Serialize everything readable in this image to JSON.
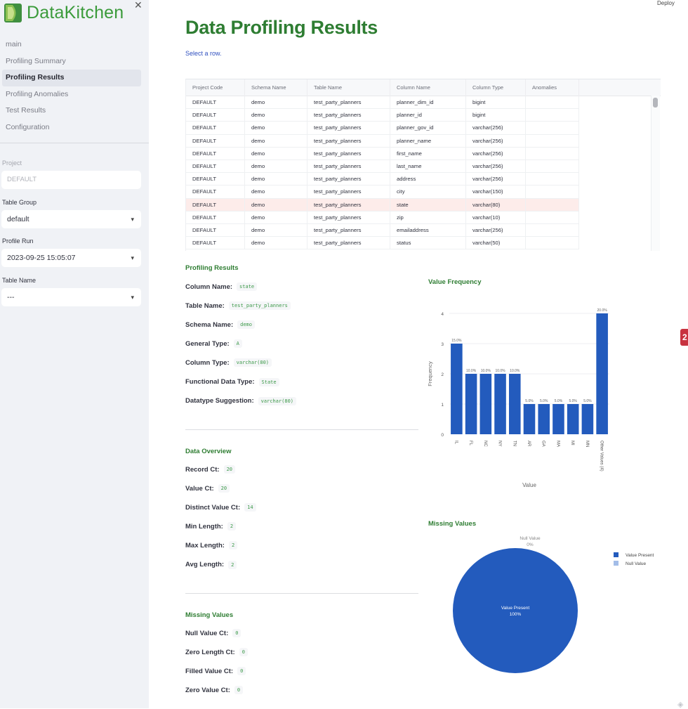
{
  "app": {
    "brand": "DataKitchen",
    "deploy_label": "Deploy",
    "notification_count": "2"
  },
  "sidebar": {
    "nav": [
      {
        "label": "main",
        "active": false
      },
      {
        "label": "Profiling Summary",
        "active": false
      },
      {
        "label": "Profiling Results",
        "active": true
      },
      {
        "label": "Profiling Anomalies",
        "active": false
      },
      {
        "label": "Test Results",
        "active": false
      },
      {
        "label": "Configuration",
        "active": false
      }
    ],
    "filters": {
      "project_label": "Project",
      "project_value": "DEFAULT",
      "table_group_label": "Table Group",
      "table_group_value": "default",
      "profile_run_label": "Profile Run",
      "profile_run_value": "2023-09-25 15:05:07",
      "table_name_label": "Table Name",
      "table_name_value": "---"
    }
  },
  "main": {
    "title": "Data Profiling Results",
    "hint": "Select a row."
  },
  "grid": {
    "columns": [
      "Project Code",
      "Schema Name",
      "Table Name",
      "Column Name",
      "Column Type",
      "Anomalies"
    ],
    "selected_index": 8,
    "rows": [
      [
        "DEFAULT",
        "demo",
        "test_party_planners",
        "planner_dim_id",
        "bigint",
        ""
      ],
      [
        "DEFAULT",
        "demo",
        "test_party_planners",
        "planner_id",
        "bigint",
        ""
      ],
      [
        "DEFAULT",
        "demo",
        "test_party_planners",
        "planner_gov_id",
        "varchar(256)",
        ""
      ],
      [
        "DEFAULT",
        "demo",
        "test_party_planners",
        "planner_name",
        "varchar(256)",
        ""
      ],
      [
        "DEFAULT",
        "demo",
        "test_party_planners",
        "first_name",
        "varchar(256)",
        ""
      ],
      [
        "DEFAULT",
        "demo",
        "test_party_planners",
        "last_name",
        "varchar(256)",
        ""
      ],
      [
        "DEFAULT",
        "demo",
        "test_party_planners",
        "address",
        "varchar(256)",
        ""
      ],
      [
        "DEFAULT",
        "demo",
        "test_party_planners",
        "city",
        "varchar(150)",
        ""
      ],
      [
        "DEFAULT",
        "demo",
        "test_party_planners",
        "state",
        "varchar(80)",
        ""
      ],
      [
        "DEFAULT",
        "demo",
        "test_party_planners",
        "zip",
        "varchar(10)",
        ""
      ],
      [
        "DEFAULT",
        "demo",
        "test_party_planners",
        "emailaddress",
        "varchar(256)",
        ""
      ],
      [
        "DEFAULT",
        "demo",
        "test_party_planners",
        "status",
        "varchar(50)",
        ""
      ]
    ]
  },
  "profiling": {
    "title": "Profiling Results",
    "items": [
      {
        "label": "Column Name:",
        "value": "state"
      },
      {
        "label": "Table Name:",
        "value": "test_party_planners"
      },
      {
        "label": "Schema Name:",
        "value": "demo"
      },
      {
        "label": "General Type:",
        "value": "A"
      },
      {
        "label": "Column Type:",
        "value": "varchar(80)"
      },
      {
        "label": "Functional Data Type:",
        "value": "State"
      },
      {
        "label": "Datatype Suggestion:",
        "value": "varchar(80)"
      }
    ]
  },
  "overview": {
    "title": "Data Overview",
    "items": [
      {
        "label": "Record Ct:",
        "value": "20"
      },
      {
        "label": "Value Ct:",
        "value": "20"
      },
      {
        "label": "Distinct Value Ct:",
        "value": "14"
      },
      {
        "label": "Min Length:",
        "value": "2"
      },
      {
        "label": "Max Length:",
        "value": "2"
      },
      {
        "label": "Avg Length:",
        "value": "2"
      }
    ]
  },
  "missing": {
    "title": "Missing Values",
    "items": [
      {
        "label": "Null Value Ct:",
        "value": "0"
      },
      {
        "label": "Zero Length Ct:",
        "value": "0"
      },
      {
        "label": "Filled Value Ct:",
        "value": "0"
      },
      {
        "label": "Zero Value Ct:",
        "value": "0"
      }
    ]
  },
  "colors": {
    "brand_green": "#2e7d32",
    "bar_blue": "#235bbd",
    "null_blue": "#a3bde8",
    "selected_row": "#fdecea"
  },
  "chart_data": [
    {
      "type": "bar",
      "title": "Value Frequency",
      "xlabel": "Value",
      "ylabel": "Frequency",
      "categories": [
        "IL",
        "FL",
        "NC",
        "NY",
        "TN",
        "AR",
        "GA",
        "MA",
        "MI",
        "MN",
        "Other Values (4)"
      ],
      "values": [
        3,
        2,
        2,
        2,
        2,
        1,
        1,
        1,
        1,
        1,
        4
      ],
      "data_labels": [
        "15.0%",
        "10.0%",
        "10.0%",
        "10.0%",
        "10.0%",
        "5.0%",
        "5.0%",
        "5.0%",
        "5.0%",
        "5.0%",
        "20.0%"
      ],
      "ylim": [
        0,
        4
      ],
      "yticks": [
        0,
        1,
        2,
        3,
        4
      ],
      "grid": true
    },
    {
      "type": "pie",
      "title": "Missing Values",
      "slices": [
        {
          "label": "Value Present",
          "value": 100,
          "text": "Value Present\n100%"
        },
        {
          "label": "Null Value",
          "value": 0,
          "text": "Null Value\n0%"
        }
      ],
      "legend": [
        "Value Present",
        "Null Value"
      ],
      "legend_position": "right"
    }
  ]
}
